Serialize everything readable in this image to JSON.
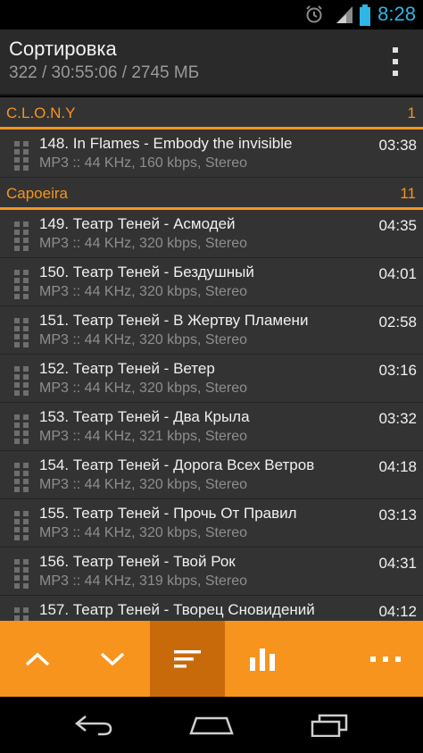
{
  "statusbar": {
    "time": "8:28",
    "icons": [
      "alarm-icon",
      "signal-icon",
      "battery-icon"
    ]
  },
  "header": {
    "title": "Сортировка",
    "subtitle": "322 / 30:55:06 / 2745 МБ",
    "menu_icon": "overflow-menu-icon"
  },
  "groups": [
    {
      "name": "C.L.O.N.Y",
      "count": "1",
      "tracks": [
        {
          "title": "148. In Flames - Embody the invisible",
          "info": "MP3 :: 44 KHz, 160 kbps, Stereo",
          "duration": "03:38"
        }
      ]
    },
    {
      "name": "Capoeira",
      "count": "11",
      "tracks": [
        {
          "title": "149. Театр Теней - Асмодей",
          "info": "MP3 :: 44 KHz, 320 kbps, Stereo",
          "duration": "04:35"
        },
        {
          "title": "150. Театр Теней - Бездушный",
          "info": "MP3 :: 44 KHz, 320 kbps, Stereo",
          "duration": "04:01"
        },
        {
          "title": "151. Театр Теней - В Жертву Пламени",
          "info": "MP3 :: 44 KHz, 320 kbps, Stereo",
          "duration": "02:58"
        },
        {
          "title": "152. Театр Теней - Ветер",
          "info": "MP3 :: 44 KHz, 320 kbps, Stereo",
          "duration": "03:16"
        },
        {
          "title": "153. Театр Теней - Два Крыла",
          "info": "MP3 :: 44 KHz, 321 kbps, Stereo",
          "duration": "03:32"
        },
        {
          "title": "154. Театр Теней - Дорога Всех Ветров",
          "info": "MP3 :: 44 KHz, 320 kbps, Stereo",
          "duration": "04:18"
        },
        {
          "title": "155. Театр Теней - Прочь От Правил",
          "info": "MP3 :: 44 KHz, 320 kbps, Stereo",
          "duration": "03:13"
        },
        {
          "title": "156. Театр Теней - Твой Рок",
          "info": "MP3 :: 44 KHz, 319 kbps, Stereo",
          "duration": "04:31"
        },
        {
          "title": "157. Театр Теней - Творец Сновидений",
          "info": "MP3 :: 44 KHz, 320 kbps, Stereo",
          "duration": "04:12"
        }
      ]
    }
  ],
  "toolbar": {
    "buttons": [
      "move-up-icon",
      "move-down-icon",
      "sort-icon",
      "equalizer-icon",
      "more-icon"
    ],
    "active": "sort-icon"
  },
  "navbar": {
    "buttons": [
      "back-icon",
      "home-icon",
      "recent-apps-icon"
    ]
  },
  "colors": {
    "accent": "#f7941d",
    "accent_dark": "#c86a0a",
    "status_blue": "#2fb5e6",
    "list_bg": "#333333",
    "header_bg": "#2a2a2a"
  }
}
